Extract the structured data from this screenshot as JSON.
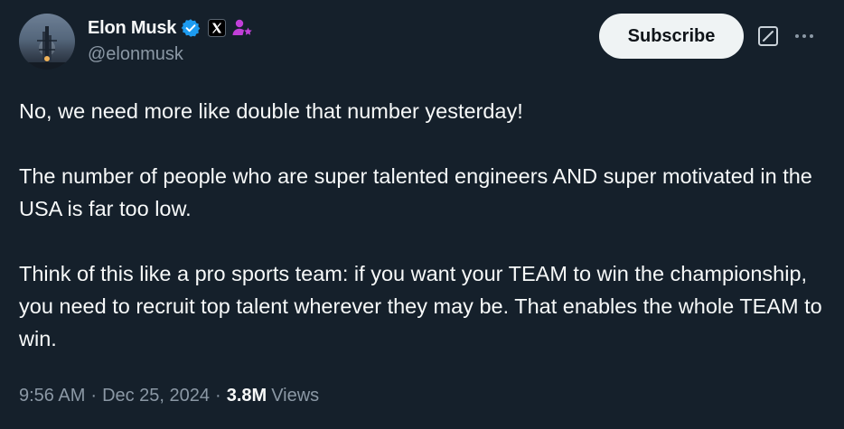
{
  "author": {
    "display_name": "Elon Musk",
    "handle": "@elonmusk",
    "verified_color": "#1d9bf0",
    "affiliate_badge": "x-logo-icon",
    "extra_badge": "person-star-icon",
    "extra_badge_color": "#c13fd8"
  },
  "header": {
    "subscribe_label": "Subscribe",
    "grok_icon": "grok-icon",
    "more_icon": "more-icon"
  },
  "tweet": {
    "paragraphs": [
      "No, we need more like double that number yesterday!",
      "The number of people who are super talented engineers AND super motivated in the USA is far too low.",
      "Think of this like a pro sports team: if you want your TEAM to win the championship, you need to recruit top talent wherever they may be. That enables the whole TEAM to win."
    ]
  },
  "meta": {
    "time": "9:56 AM",
    "separator": "·",
    "date": "Dec 25, 2024",
    "views_count": "3.8M",
    "views_label": "Views"
  },
  "colors": {
    "background": "#15202b",
    "text_primary": "#f7f9f9",
    "text_secondary": "#8b98a5",
    "button_bg": "#eff3f4",
    "button_text": "#0f1419"
  }
}
